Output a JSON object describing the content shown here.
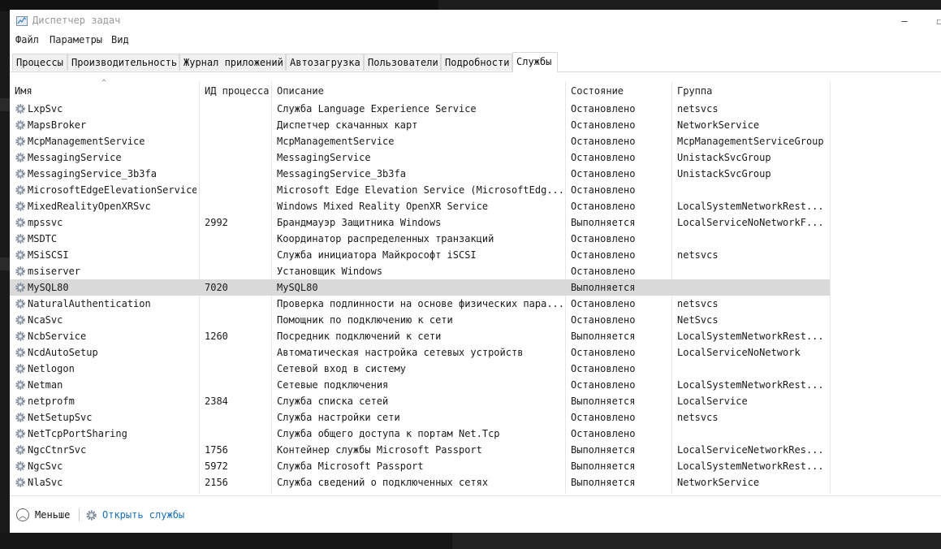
{
  "window": {
    "title": "Диспетчер задач",
    "minimize": "—",
    "maximize": "☐"
  },
  "menu": [
    "Файл",
    "Параметры",
    "Вид"
  ],
  "tabs": [
    "Процессы",
    "Производительность",
    "Журнал приложений",
    "Автозагрузка",
    "Пользователи",
    "Подробности",
    "Службы"
  ],
  "active_tab": "Службы",
  "columns": [
    "Имя",
    "ИД процесса",
    "Описание",
    "Состояние",
    "Группа"
  ],
  "sorted_column": "Имя",
  "rows": [
    {
      "name": "LxpSvc",
      "pid": "",
      "desc": "Служба Language Experience Service",
      "state": "Остановлено",
      "group": "netsvcs"
    },
    {
      "name": "MapsBroker",
      "pid": "",
      "desc": "Диспетчер скачанных карт",
      "state": "Остановлено",
      "group": "NetworkService"
    },
    {
      "name": "McpManagementService",
      "pid": "",
      "desc": "McpManagementService",
      "state": "Остановлено",
      "group": "McpManagementServiceGroup"
    },
    {
      "name": "MessagingService",
      "pid": "",
      "desc": "MessagingService",
      "state": "Остановлено",
      "group": "UnistackSvcGroup"
    },
    {
      "name": "MessagingService_3b3fa",
      "pid": "",
      "desc": "MessagingService_3b3fa",
      "state": "Остановлено",
      "group": "UnistackSvcGroup"
    },
    {
      "name": "MicrosoftEdgeElevationService",
      "pid": "",
      "desc": "Microsoft Edge Elevation Service (MicrosoftEdg...",
      "state": "Остановлено",
      "group": ""
    },
    {
      "name": "MixedRealityOpenXRSvc",
      "pid": "",
      "desc": "Windows Mixed Reality OpenXR Service",
      "state": "Остановлено",
      "group": "LocalSystemNetworkRest..."
    },
    {
      "name": "mpssvc",
      "pid": "2992",
      "desc": "Брандмауэр Защитника Windows",
      "state": "Выполняется",
      "group": "LocalServiceNoNetworkF..."
    },
    {
      "name": "MSDTC",
      "pid": "",
      "desc": "Координатор распределенных транзакций",
      "state": "Остановлено",
      "group": ""
    },
    {
      "name": "MSiSCSI",
      "pid": "",
      "desc": "Служба инициатора Майкрософт iSCSI",
      "state": "Остановлено",
      "group": "netsvcs"
    },
    {
      "name": "msiserver",
      "pid": "",
      "desc": "Установщик Windows",
      "state": "Остановлено",
      "group": ""
    },
    {
      "name": "MySQL80",
      "pid": "7020",
      "desc": "MySQL80",
      "state": "Выполняется",
      "group": "",
      "selected": true
    },
    {
      "name": "NaturalAuthentication",
      "pid": "",
      "desc": "Проверка подлинности на основе физических пара...",
      "state": "Остановлено",
      "group": "netsvcs"
    },
    {
      "name": "NcaSvc",
      "pid": "",
      "desc": "Помощник по подключению к сети",
      "state": "Остановлено",
      "group": "NetSvcs"
    },
    {
      "name": "NcbService",
      "pid": "1260",
      "desc": "Посредник подключений к сети",
      "state": "Выполняется",
      "group": "LocalSystemNetworkRest..."
    },
    {
      "name": "NcdAutoSetup",
      "pid": "",
      "desc": "Автоматическая настройка сетевых устройств",
      "state": "Остановлено",
      "group": "LocalServiceNoNetwork"
    },
    {
      "name": "Netlogon",
      "pid": "",
      "desc": "Сетевой вход в систему",
      "state": "Остановлено",
      "group": ""
    },
    {
      "name": "Netman",
      "pid": "",
      "desc": "Сетевые подключения",
      "state": "Остановлено",
      "group": "LocalSystemNetworkRest..."
    },
    {
      "name": "netprofm",
      "pid": "2384",
      "desc": "Служба списка сетей",
      "state": "Выполняется",
      "group": "LocalService"
    },
    {
      "name": "NetSetupSvc",
      "pid": "",
      "desc": "Служба настройки сети",
      "state": "Остановлено",
      "group": "netsvcs"
    },
    {
      "name": "NetTcpPortSharing",
      "pid": "",
      "desc": "Служба общего доступа к портам Net.Tcp",
      "state": "Остановлено",
      "group": ""
    },
    {
      "name": "NgcCtnrSvc",
      "pid": "1756",
      "desc": "Контейнер службы Microsoft Passport",
      "state": "Выполняется",
      "group": "LocalServiceNetworkRes..."
    },
    {
      "name": "NgcSvc",
      "pid": "5972",
      "desc": "Служба Microsoft Passport",
      "state": "Выполняется",
      "group": "LocalSystemNetworkRest..."
    },
    {
      "name": "NlaSvc",
      "pid": "2156",
      "desc": "Служба сведений о подключенных сетях",
      "state": "Выполняется",
      "group": "NetworkService"
    }
  ],
  "footer": {
    "fewer": "Меньше",
    "open_services": "Открыть службы"
  },
  "colors": {
    "selected_row": "#d9d9d9",
    "link": "#1a6fb5"
  }
}
